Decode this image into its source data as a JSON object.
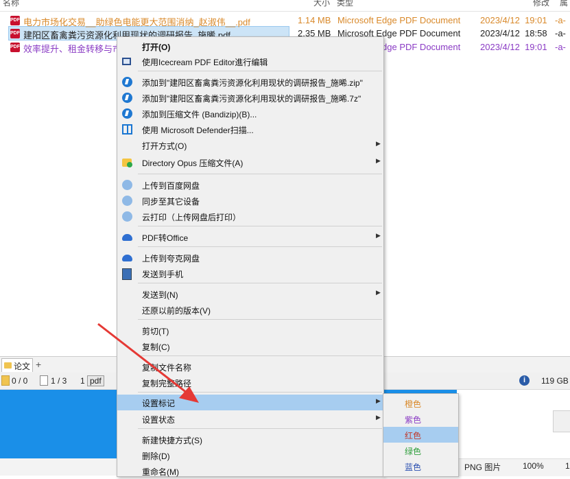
{
  "header": {
    "col_name": "名称",
    "col_size": "大小",
    "col_type": "类型",
    "col_modified": "修改",
    "col_attr": "属"
  },
  "files": [
    {
      "name": "电力市场化交易__助绿色电能更大范围消纳_赵淑伟__.pdf",
      "size": "1.14 MB",
      "type": "Microsoft Edge PDF Document",
      "date": "2023/4/12",
      "time": "19:01",
      "attr": "-a-",
      "color": "#d9892a",
      "selected": false
    },
    {
      "name": "建阳区畜禽粪污资源化利用现状的调研报告_施晞.pdf",
      "size": "2.35 MB",
      "type": "Microsoft Edge PDF Document",
      "date": "2023/4/12",
      "time": "18:58",
      "attr": "-a-",
      "color": "#222222",
      "selected": true
    },
    {
      "name": "效率提升、租金转移与市",
      "size": "",
      "type": "Microsoft Edge PDF Document",
      "date": "2023/4/12",
      "time": "19:01",
      "attr": "-a-",
      "color": "#8a3bc4",
      "selected": false
    }
  ],
  "tabbar": {
    "tab_label": "论文",
    "add_label": "+"
  },
  "statusbar": {
    "dirs": "0 / 0",
    "files": "1 / 3",
    "selected_count": "1",
    "file_type": "pdf",
    "free_space": "119 GB"
  },
  "lowbar": {
    "format": "PNG 图片",
    "zoom": "100%",
    "extra": "1"
  },
  "context_menu": {
    "items": [
      {
        "label": "打开(O)",
        "bold": true,
        "icon": ""
      },
      {
        "label": "使用Icecream PDF Editor進行编辑",
        "icon": "icecream-icon"
      },
      {
        "label": "添加到\"建阳区畜禽粪污资源化利用现状的调研报告_施晞.zip\"",
        "icon": "bandizip-icon"
      },
      {
        "label": "添加到\"建阳区畜禽粪污资源化利用现状的调研报告_施晞.7z\"",
        "icon": "bandizip-icon"
      },
      {
        "label": "添加到压缩文件 (Bandizip)(B)...",
        "icon": "bandizip-icon"
      },
      {
        "label": "使用 Microsoft Defender扫描...",
        "icon": "defender-icon"
      },
      {
        "label": "打开方式(O)",
        "icon": "",
        "submenu": true
      },
      {
        "label": "Directory Opus 压缩文件(A)",
        "icon": "opus-icon",
        "submenu": true
      },
      {
        "label": "上传到百度网盘",
        "icon": "baidu-icon"
      },
      {
        "label": "同步至其它设备",
        "icon": "baidu-icon"
      },
      {
        "label": "云打印（上传网盘后打印）",
        "icon": "baidu-icon"
      },
      {
        "label": "PDF转Office",
        "icon": "cloud-icon",
        "submenu": true
      },
      {
        "label": "上传到夸克网盘",
        "icon": "quark-icon"
      },
      {
        "label": "发送到手机",
        "icon": "phone-icon"
      },
      {
        "label": "发送到(N)",
        "icon": "",
        "submenu": true
      },
      {
        "label": "还原以前的版本(V)",
        "icon": ""
      },
      {
        "label": "剪切(T)",
        "icon": ""
      },
      {
        "label": "复制(C)",
        "icon": ""
      },
      {
        "label": "复制文件名称",
        "icon": ""
      },
      {
        "label": "复制完整路径",
        "icon": ""
      },
      {
        "label": "设置标记",
        "icon": "",
        "submenu": true,
        "highlighted": true
      },
      {
        "label": "设置状态",
        "icon": "",
        "submenu": true
      },
      {
        "label": "新建快捷方式(S)",
        "icon": ""
      },
      {
        "label": "删除(D)",
        "icon": ""
      },
      {
        "label": "重命名(M)",
        "icon": ""
      }
    ]
  },
  "submenu": {
    "items": [
      {
        "label": "橙色",
        "color": "#d9892a"
      },
      {
        "label": "紫色",
        "color": "#8a3bc4"
      },
      {
        "label": "红色",
        "color": "#c0392b",
        "highlighted": true
      },
      {
        "label": "绿色",
        "color": "#2e9e3c"
      },
      {
        "label": "蓝色",
        "color": "#2a4fb0"
      }
    ]
  },
  "annotation": {
    "arrow_color": "#e53935"
  }
}
